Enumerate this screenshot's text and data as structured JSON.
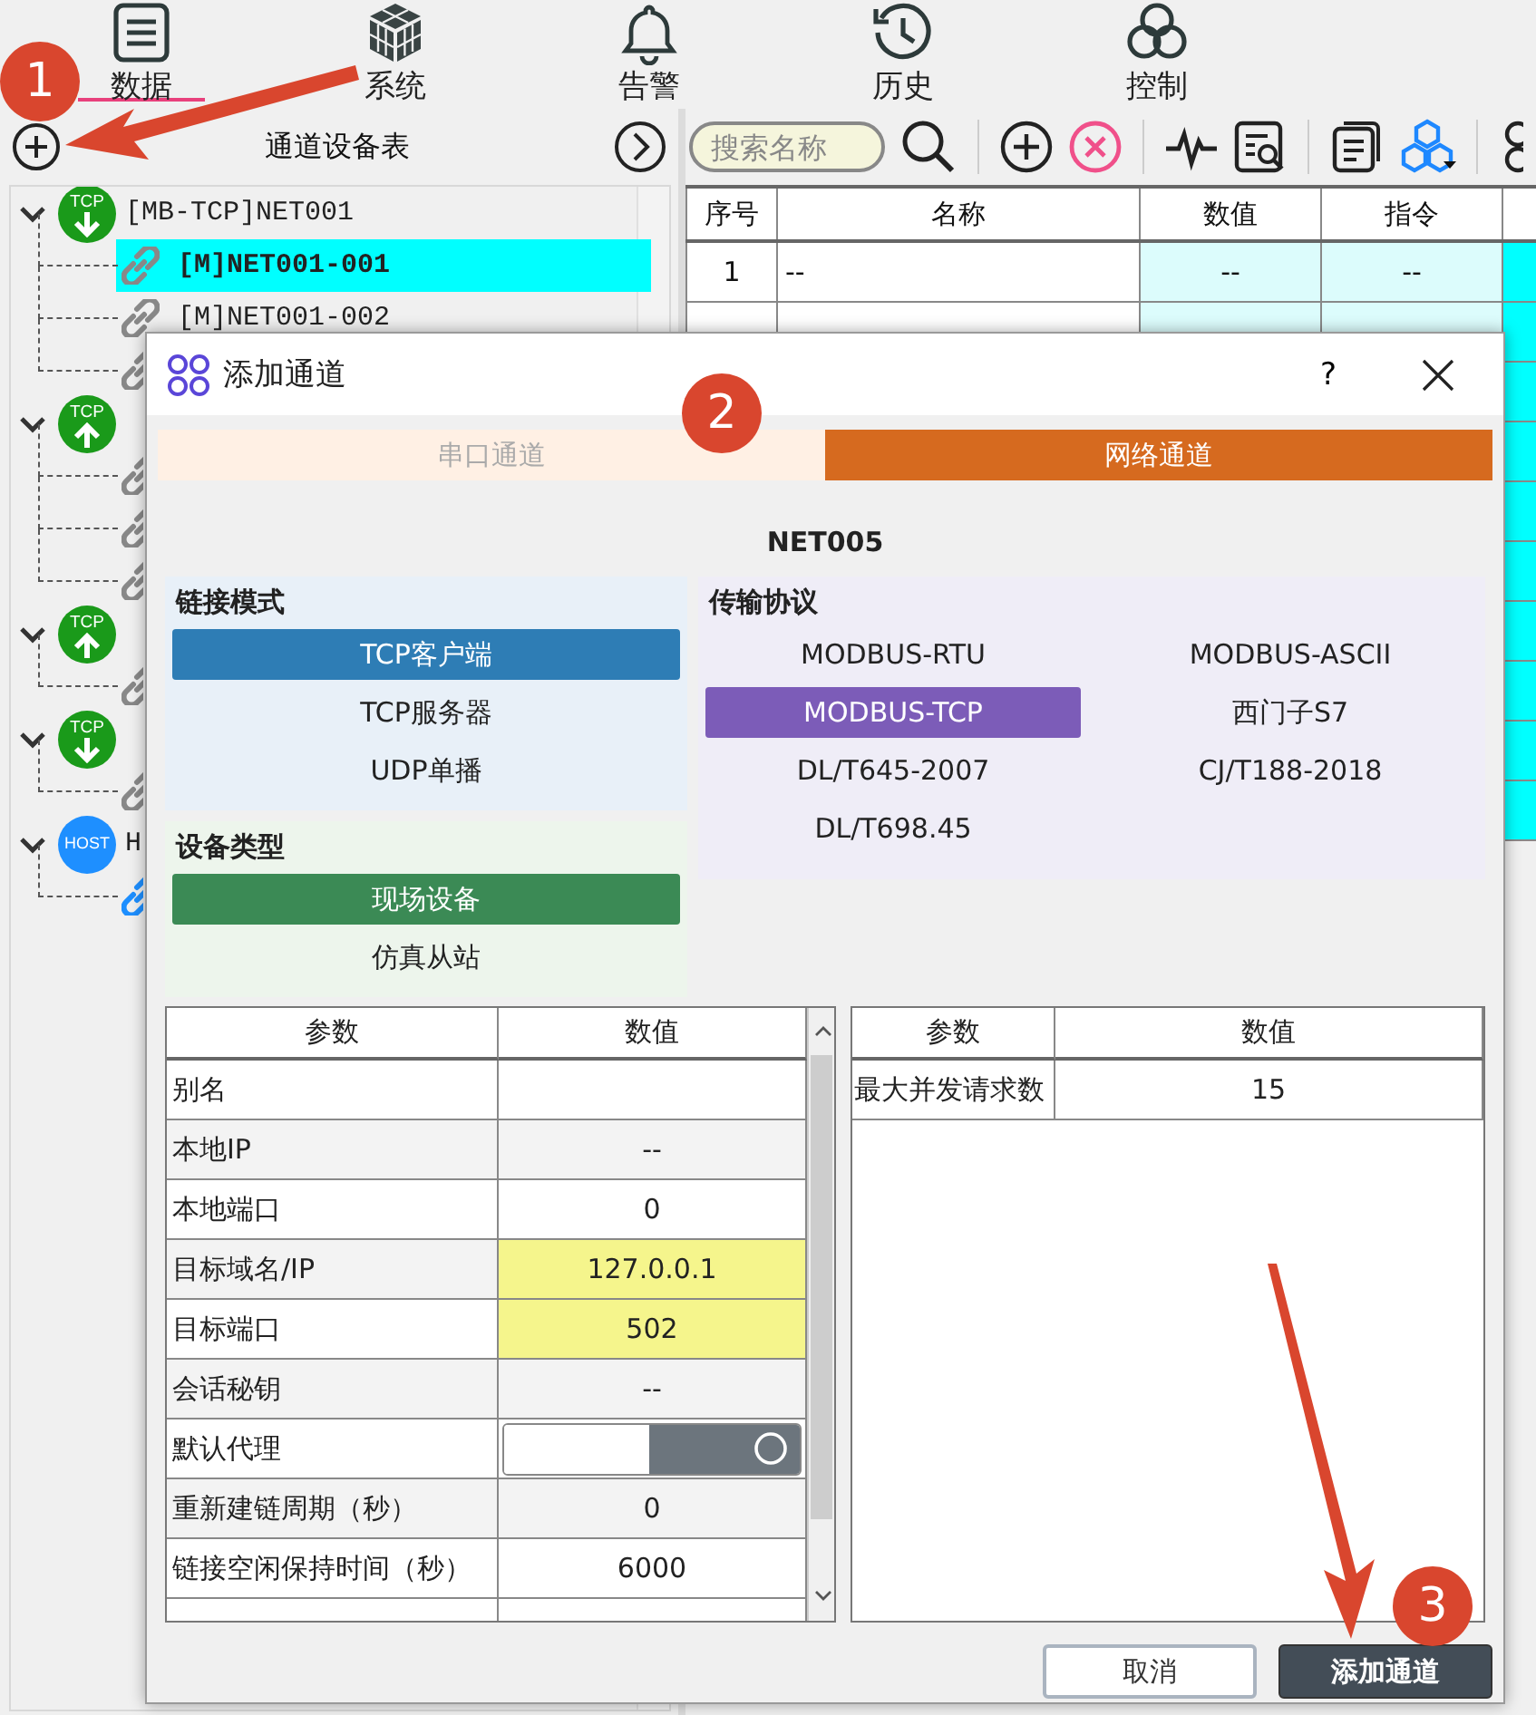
{
  "nav": [
    {
      "label": "数据",
      "kind": "list",
      "selected": true
    },
    {
      "label": "系统",
      "kind": "cube",
      "selected": false
    },
    {
      "label": "告警",
      "kind": "bell",
      "selected": false
    },
    {
      "label": "历史",
      "kind": "history",
      "selected": false
    },
    {
      "label": "控制",
      "kind": "knot",
      "selected": false
    }
  ],
  "left_panel": {
    "title": "通道设备表",
    "tree": [
      {
        "badge": "TCP",
        "kind": "tcp-down",
        "label": "[MB-TCP]NET001",
        "expanded": true,
        "children": [
          {
            "label": "[M]NET001-001",
            "selected": true
          },
          {
            "label": "[M]NET001-002",
            "selected": false
          },
          {
            "selected": false
          }
        ]
      },
      {
        "badge": "TCP",
        "kind": "tcp-up",
        "expanded": true,
        "children": [
          {
            "selected": false
          },
          {
            "selected": false
          },
          {
            "selected": false
          }
        ]
      },
      {
        "badge": "TCP",
        "kind": "tcp-up",
        "expanded": true,
        "children": [
          {
            "selected": false
          }
        ]
      },
      {
        "badge": "TCP",
        "kind": "tcp-down",
        "expanded": true,
        "children": [
          {
            "selected": false
          }
        ]
      },
      {
        "badge": "HOST",
        "kind": "host",
        "label": "H",
        "expanded": true,
        "children": [
          {
            "selected": false
          }
        ]
      }
    ]
  },
  "right_panel": {
    "search": {
      "placeholder": "搜索名称"
    },
    "table": {
      "columns": [
        "序号",
        "名称",
        "数值",
        "指令"
      ],
      "rows": [
        {
          "cells": [
            "1",
            "--",
            "--",
            "--"
          ]
        }
      ]
    }
  },
  "dialog": {
    "title": "添加通道",
    "help": "?",
    "tabs": [
      {
        "label": "串口通道",
        "selected": false
      },
      {
        "label": "网络通道",
        "selected": true
      }
    ],
    "channel_name": "NET005",
    "link_mode": {
      "title": "链接模式",
      "options": [
        {
          "label": "TCP客户端",
          "selected": true
        },
        {
          "label": "TCP服务器",
          "selected": false
        },
        {
          "label": "UDP单播",
          "selected": false
        }
      ]
    },
    "device_type": {
      "title": "设备类型",
      "options": [
        {
          "label": "现场设备",
          "selected": true
        },
        {
          "label": "仿真从站",
          "selected": false
        }
      ]
    },
    "protocol": {
      "title": "传输协议",
      "options": [
        {
          "label": "MODBUS-RTU",
          "selected": false
        },
        {
          "label": "MODBUS-ASCII",
          "selected": false
        },
        {
          "label": "MODBUS-TCP",
          "selected": true
        },
        {
          "label": "西门子S7",
          "selected": false
        },
        {
          "label": "DL/T645-2007",
          "selected": false
        },
        {
          "label": "CJ/T188-2018",
          "selected": false
        },
        {
          "label": "DL/T698.45",
          "selected": false
        }
      ]
    },
    "params": {
      "columns": [
        "参数",
        "数值"
      ],
      "rows": [
        {
          "name": "别名",
          "kind": "text",
          "highlighted": false
        },
        {
          "name": "本地IP",
          "kind": "text",
          "value": "--",
          "highlighted": false
        },
        {
          "name": "本地端口",
          "kind": "text",
          "value": "0",
          "highlighted": false
        },
        {
          "name": "目标域名/IP",
          "kind": "text",
          "value": "127.0.0.1",
          "highlighted": true
        },
        {
          "name": "目标端口",
          "kind": "text",
          "value": "502",
          "highlighted": true
        },
        {
          "name": "会话秘钥",
          "kind": "text",
          "value": "--",
          "highlighted": false
        },
        {
          "name": "默认代理",
          "kind": "toggle",
          "on": false,
          "highlighted": false
        },
        {
          "name": "重新建链周期（秒）",
          "kind": "text",
          "value": "0",
          "highlighted": false
        },
        {
          "name": "链接空闲保持时间（秒）",
          "kind": "text",
          "value": "6000",
          "highlighted": false
        }
      ]
    },
    "extra_params": {
      "columns": [
        "参数",
        "数值"
      ],
      "rows": [
        {
          "name": "最大并发请求数",
          "value": "15"
        }
      ]
    },
    "buttons": [
      {
        "label": "取消",
        "kind": "secondary"
      },
      {
        "label": "添加通道",
        "kind": "primary"
      }
    ]
  },
  "annotations": [
    {
      "number": "1",
      "arrow": true
    },
    {
      "number": "2",
      "arrow": false
    },
    {
      "number": "3",
      "arrow": true
    }
  ]
}
